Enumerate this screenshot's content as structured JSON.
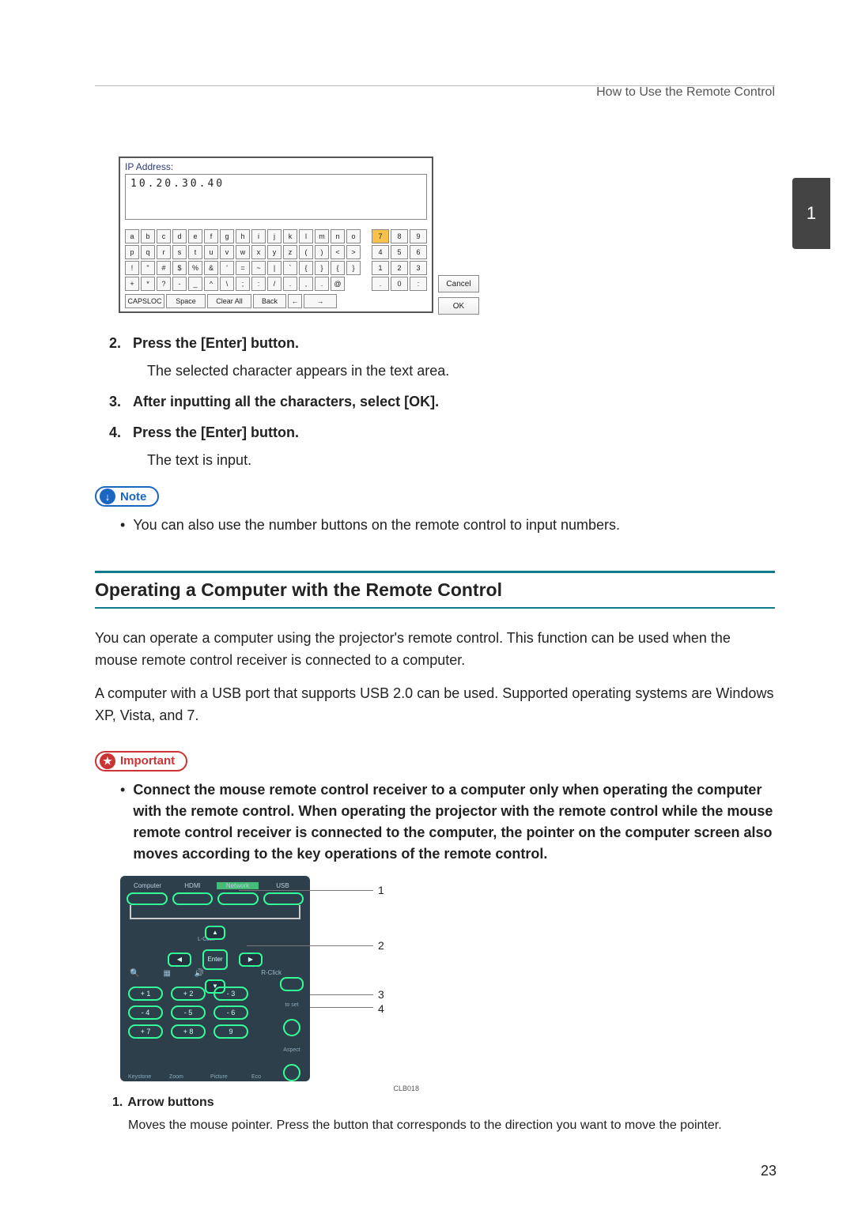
{
  "header": {
    "title": "How to Use the Remote Control"
  },
  "chapter_tab": "1",
  "page_number": "23",
  "ip_fig": {
    "title": "IP Address:",
    "value": "10.20.30.40",
    "rows": {
      "r1": [
        "a",
        "b",
        "c",
        "d",
        "e",
        "f",
        "g",
        "h",
        "i",
        "j",
        "k",
        "l",
        "m",
        "n",
        "o"
      ],
      "r2": [
        "p",
        "q",
        "r",
        "s",
        "t",
        "u",
        "v",
        "w",
        "x",
        "y",
        "z",
        "(",
        ")",
        "<",
        ">"
      ],
      "r3": [
        "!",
        "\"",
        "#",
        "$",
        "%",
        "&",
        "'",
        "=",
        "~",
        "|",
        "`",
        "{",
        "}",
        "{",
        "}"
      ],
      "r4": [
        "+",
        "*",
        "?",
        "-",
        "_",
        "^",
        "\\",
        ";",
        ":",
        "/",
        ".",
        ",",
        ".",
        "@"
      ]
    },
    "bottom": {
      "caps": "CAPSLOC",
      "space": "Space",
      "clear": "Clear All",
      "back": "Back",
      "left": "←",
      "right": "→"
    },
    "numpad": [
      [
        "7",
        "8",
        "9"
      ],
      [
        "4",
        "5",
        "6"
      ],
      [
        "1",
        "2",
        "3"
      ],
      [
        ".",
        "0",
        ":"
      ]
    ],
    "side": {
      "cancel": "Cancel",
      "ok": "OK"
    }
  },
  "steps": {
    "s2": {
      "num": "2.",
      "head": "Press the [Enter] button.",
      "body": "The selected character appears in the text area."
    },
    "s3": {
      "num": "3.",
      "head": "After inputting all the characters, select [OK]."
    },
    "s4": {
      "num": "4.",
      "head": "Press the [Enter] button.",
      "body": "The text is input."
    }
  },
  "note": {
    "label": "Note",
    "bullet": "You can also use the number buttons on the remote control to input numbers."
  },
  "section": {
    "title": "Operating a Computer with the Remote Control"
  },
  "paras": {
    "p1": "You can operate a computer using the projector's remote control. This function can be used when the mouse remote control receiver is connected to a computer.",
    "p2": "A computer with a USB port that supports USB 2.0 can be used. Supported operating systems are Windows XP, Vista, and 7."
  },
  "important": {
    "label": "Important",
    "bullet": "Connect the mouse remote control receiver to a computer only when operating the computer with the remote control. When operating the projector with the remote control while the mouse remote control receiver is connected to the computer, the pointer on the computer screen also moves according to the key operations of the remote control."
  },
  "remote": {
    "tabs": [
      "Computer",
      "HDMI",
      "Network",
      "USB"
    ],
    "lclick": "L-Click",
    "enter": "Enter",
    "rclick": "R-Click",
    "nums": [
      "+ 1",
      "+ 2",
      "- 3",
      "- 4",
      "- 5",
      "- 6",
      "+ 7",
      "+ 8",
      "9"
    ],
    "row_labels": [
      "Magnify",
      "Page",
      "",
      "",
      "Keystone",
      "Zoom",
      "Picture",
      "Eco"
    ],
    "btn_labels": {
      "toset": "to set",
      "aspect": "Aspect"
    },
    "callouts": {
      "c1": "1",
      "c2": "2",
      "c3": "3",
      "c4": "4"
    },
    "figcode": "CLB018"
  },
  "defs": {
    "d1": {
      "num": "1.",
      "head": "Arrow buttons",
      "body": "Moves the mouse pointer. Press the button that corresponds to the direction you want to move the pointer."
    }
  }
}
